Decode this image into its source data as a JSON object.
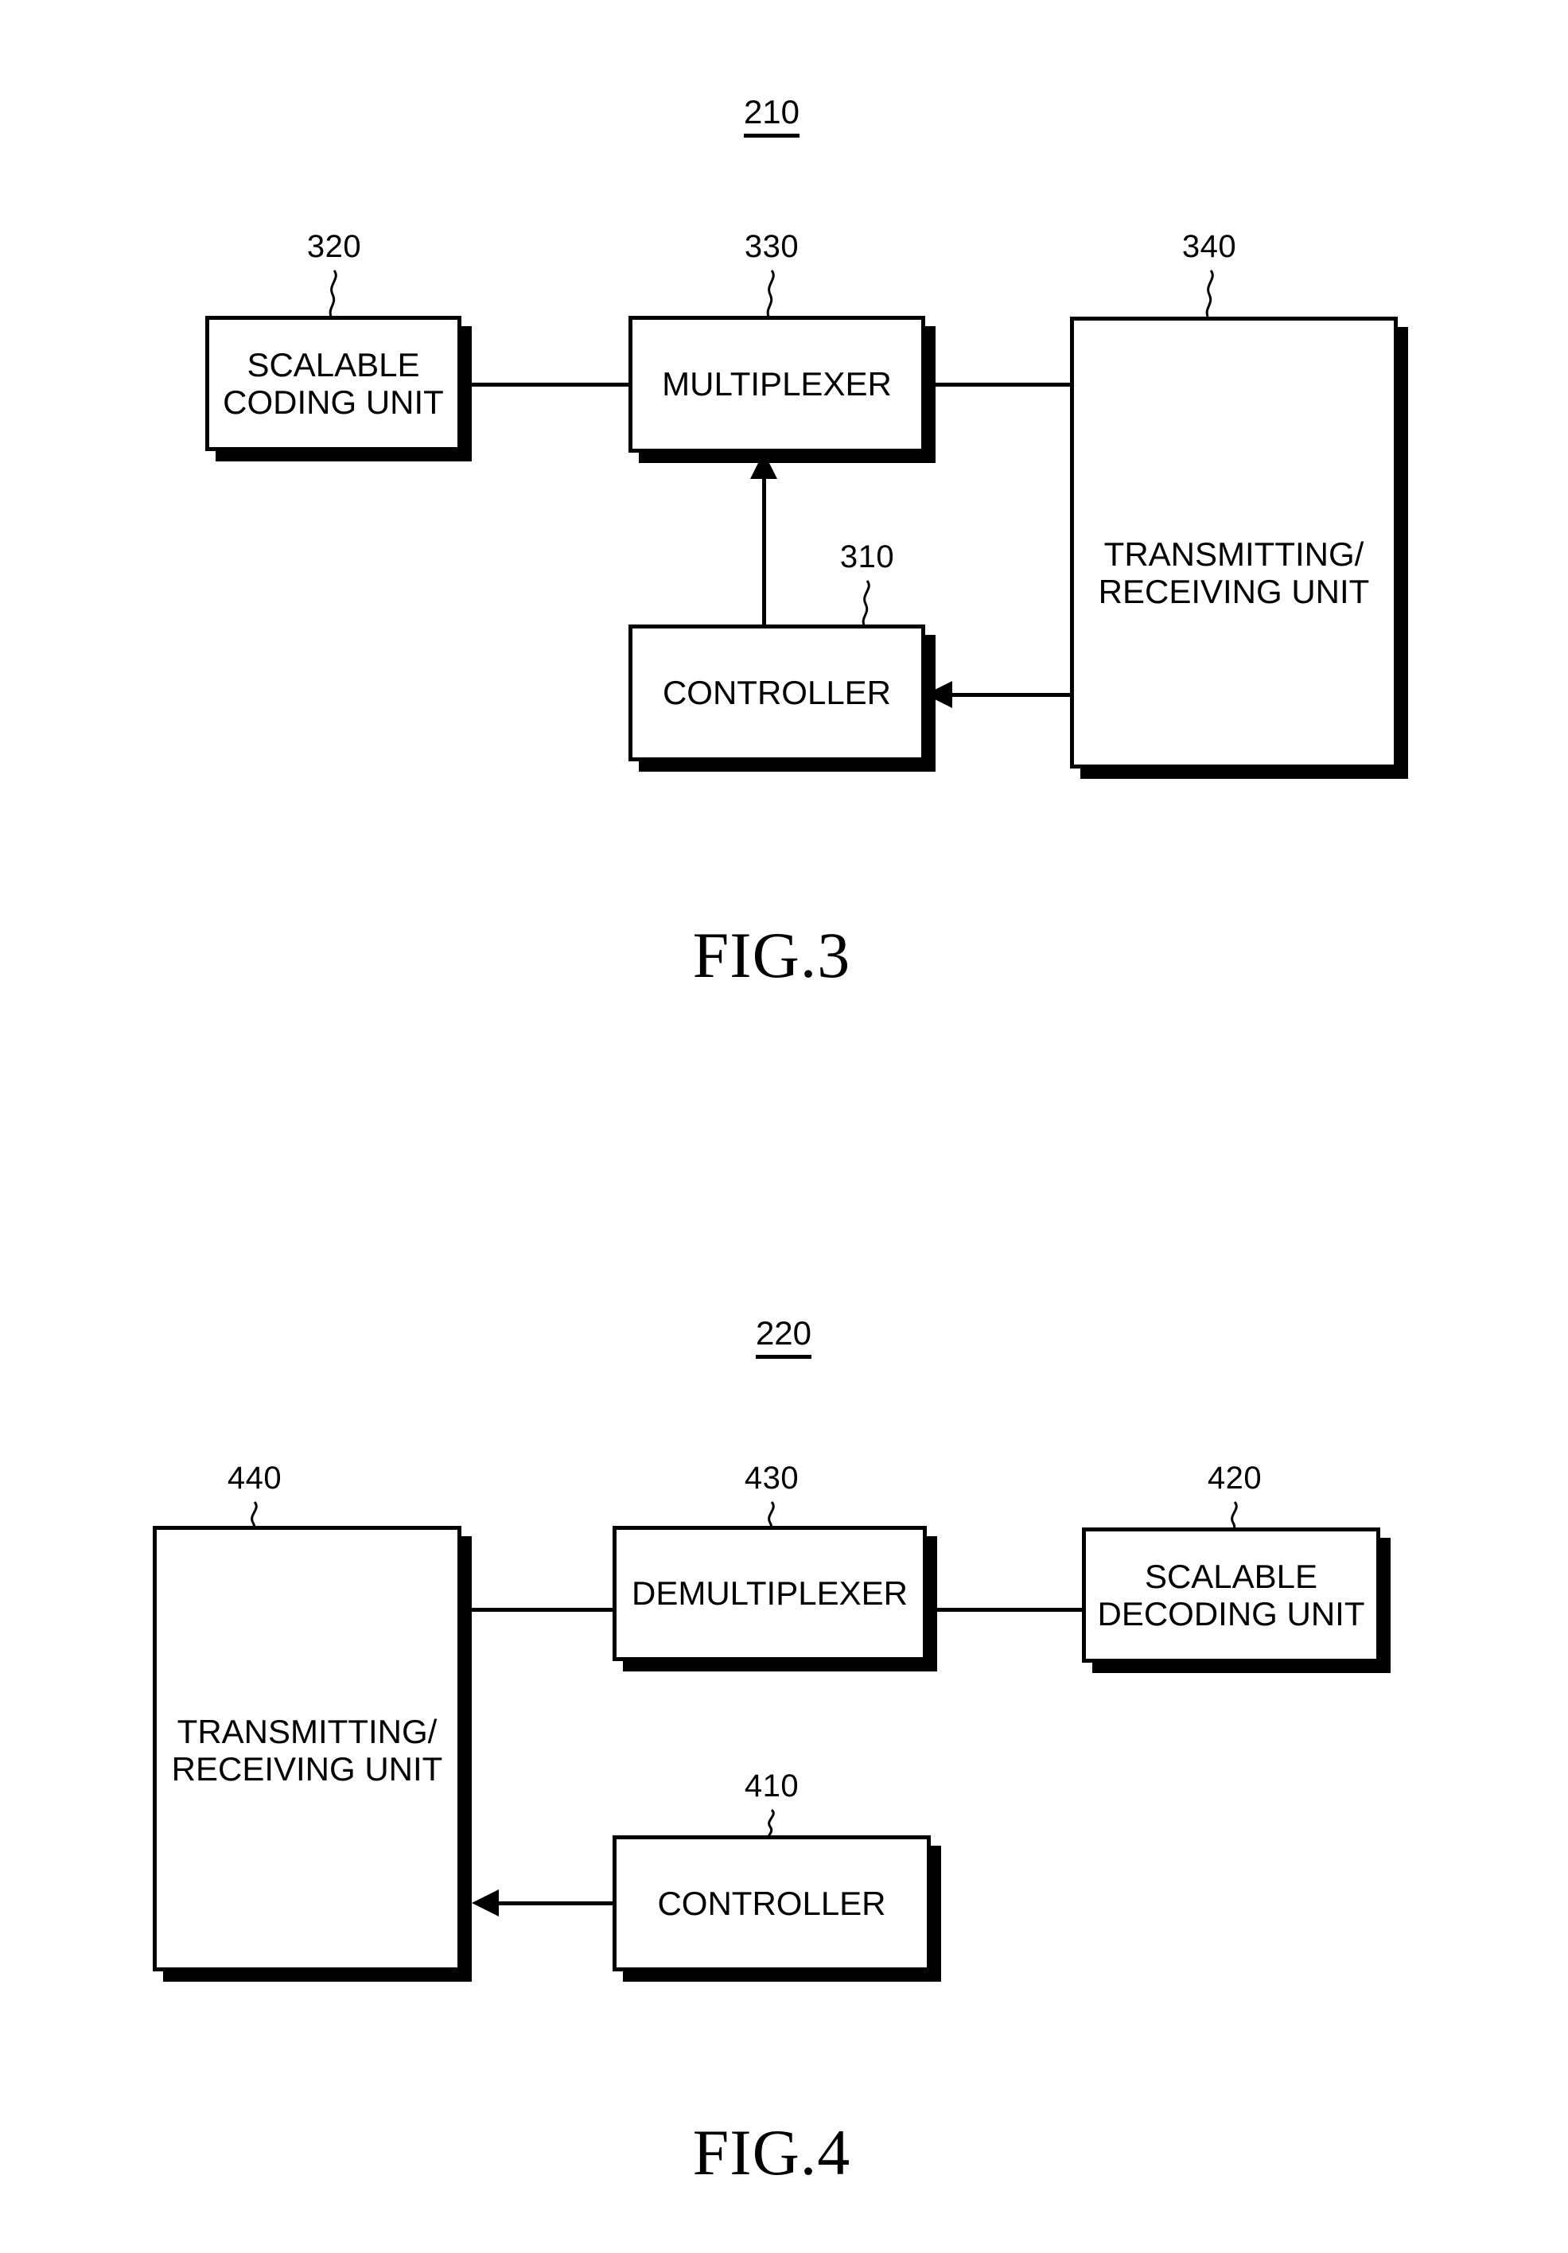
{
  "figures": [
    {
      "id": "fig3",
      "caption": "FIG.3",
      "group_numeral": "210",
      "blocks": [
        {
          "ref": "320",
          "label": "SCALABLE\nCODING UNIT"
        },
        {
          "ref": "330",
          "label": "MULTIPLEXER"
        },
        {
          "ref": "340",
          "label": "TRANSMITTING/\nRECEIVING UNIT"
        },
        {
          "ref": "310",
          "label": "CONTROLLER"
        }
      ]
    },
    {
      "id": "fig4",
      "caption": "FIG.4",
      "group_numeral": "220",
      "blocks": [
        {
          "ref": "440",
          "label": "TRANSMITTING/\nRECEIVING UNIT"
        },
        {
          "ref": "430",
          "label": "DEMULTIPLEXER"
        },
        {
          "ref": "420",
          "label": "SCALABLE\nDECODING UNIT"
        },
        {
          "ref": "410",
          "label": "CONTROLLER"
        }
      ]
    }
  ],
  "colors": {
    "ink": "#000000",
    "paper": "#ffffff"
  }
}
